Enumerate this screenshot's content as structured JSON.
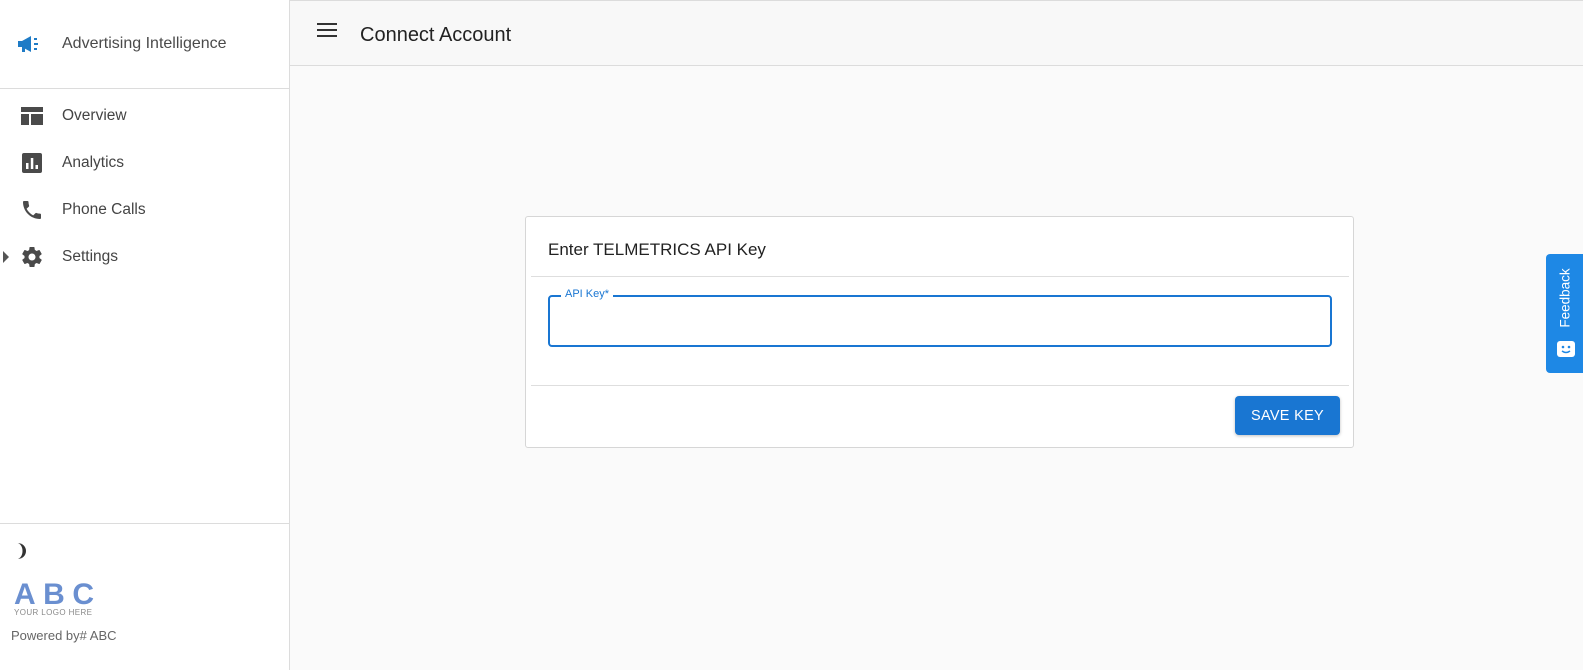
{
  "brand": {
    "title": "Advertising Intelligence",
    "icon": "megaphone-icon",
    "accent": "#1e7bc6"
  },
  "sidebar": {
    "items": [
      {
        "label": "Overview",
        "icon": "dashboard-icon"
      },
      {
        "label": "Analytics",
        "icon": "analytics-icon"
      },
      {
        "label": "Phone Calls",
        "icon": "phone-icon"
      },
      {
        "label": "Settings",
        "icon": "gear-icon"
      }
    ],
    "footer": {
      "logo_main": "ABC",
      "logo_sub": "YOUR LOGO HERE",
      "powered_by": "Powered by# ABC"
    }
  },
  "header": {
    "title": "Connect Account"
  },
  "card": {
    "title": "Enter TELMETRICS API Key",
    "field_label": "API Key*",
    "field_value": "",
    "save_label": "SAVE KEY"
  },
  "feedback": {
    "label": "Feedback"
  },
  "colors": {
    "primary": "#1976d2",
    "feedback": "#1e88e5"
  }
}
